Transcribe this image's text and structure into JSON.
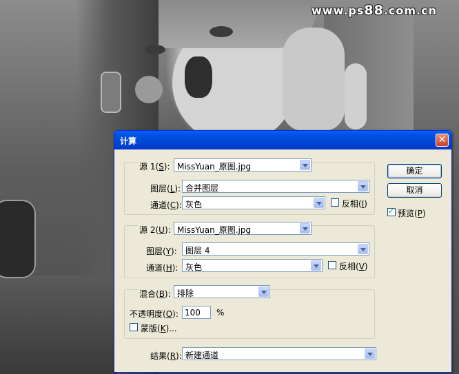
{
  "watermark": {
    "prefix": "www.ps",
    "digits": "88",
    "suffix": ".com.cn"
  },
  "dialog": {
    "title": "计算",
    "close_symbol": "✕",
    "source1": {
      "label": "源 1(",
      "hotkey": "S",
      "label_end": "):",
      "file": "MissYuan_原图.jpg",
      "layer_label": "图层(",
      "layer_hotkey": "L",
      "layer_end": "):",
      "layer": "合并图层",
      "channel_label": "通道(",
      "channel_hotkey": "C",
      "channel_end": "):",
      "channel": "灰色",
      "invert_label": "反相(",
      "invert_hotkey": "I",
      "invert_end": ")",
      "invert_checked": false
    },
    "source2": {
      "label": "源 2(",
      "hotkey": "U",
      "label_end": "):",
      "file": "MissYuan_原图.jpg",
      "layer_label": "图层(",
      "layer_hotkey": "Y",
      "layer_end": "):",
      "layer": "图层 4",
      "channel_label": "通道(",
      "channel_hotkey": "H",
      "channel_end": "):",
      "channel": "灰色",
      "invert_label": "反相(",
      "invert_hotkey": "V",
      "invert_end": ")",
      "invert_checked": false
    },
    "blend": {
      "label": "混合(",
      "hotkey": "B",
      "label_end": "):",
      "mode": "排除",
      "opacity_label": "不透明度(",
      "opacity_hotkey": "O",
      "opacity_end": "):",
      "opacity_value": "100",
      "opacity_unit": "%",
      "mask_label": "蒙版(",
      "mask_hotkey": "K",
      "mask_end": ")...",
      "mask_checked": false
    },
    "result": {
      "label": "结果(",
      "hotkey": "R",
      "label_end": "):",
      "value": "新建通道"
    },
    "buttons": {
      "ok": "确定",
      "cancel": "取消"
    },
    "preview": {
      "label": "预览(",
      "hotkey": "P",
      "label_end": ")",
      "checked": true
    }
  }
}
